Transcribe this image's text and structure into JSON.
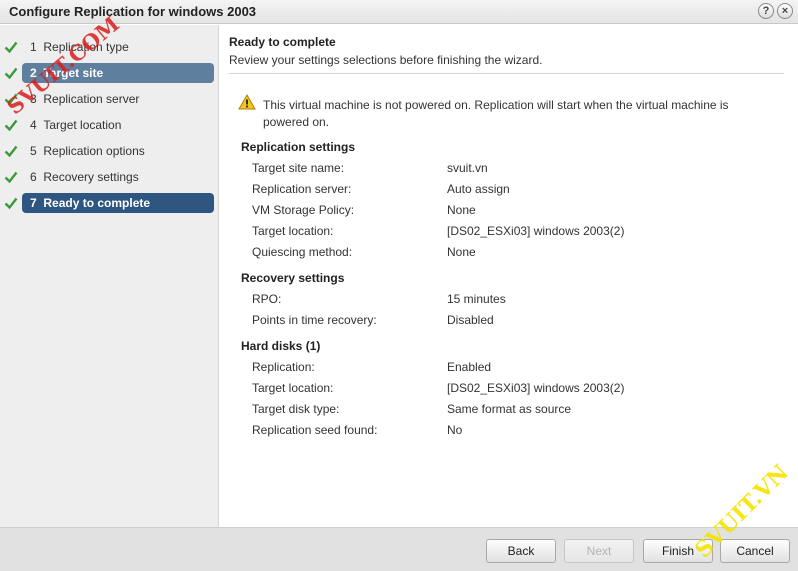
{
  "window": {
    "title": "Configure Replication for windows 2003",
    "help_glyph": "?",
    "close_glyph": "×"
  },
  "steps": [
    {
      "num": "1",
      "label": "Replication type",
      "state": "done"
    },
    {
      "num": "2",
      "label": "Target site",
      "state": "done-highlight"
    },
    {
      "num": "3",
      "label": "Replication server",
      "state": "done"
    },
    {
      "num": "4",
      "label": "Target location",
      "state": "done"
    },
    {
      "num": "5",
      "label": "Replication options",
      "state": "done"
    },
    {
      "num": "6",
      "label": "Recovery settings",
      "state": "done"
    },
    {
      "num": "7",
      "label": "Ready to complete",
      "state": "current"
    }
  ],
  "header": {
    "title": "Ready to complete",
    "subtitle": "Review your settings selections before finishing the wizard."
  },
  "warning": {
    "text": "This virtual machine is not powered on. Replication will start when the virtual machine is powered on."
  },
  "sections": {
    "replication": {
      "title": "Replication settings",
      "rows": [
        {
          "label": "Target site name:",
          "value": "svuit.vn"
        },
        {
          "label": "Replication server:",
          "value": "Auto assign"
        },
        {
          "label": "VM Storage Policy:",
          "value": "None"
        },
        {
          "label": "Target location:",
          "value": "[DS02_ESXi03] windows 2003(2)"
        },
        {
          "label": "Quiescing method:",
          "value": "None"
        }
      ]
    },
    "recovery": {
      "title": "Recovery settings",
      "rows": [
        {
          "label": "RPO:",
          "value": "15 minutes"
        },
        {
          "label": "Points in time recovery:",
          "value": "Disabled"
        }
      ]
    },
    "disks": {
      "title": "Hard disks (1)",
      "rows": [
        {
          "label": "Replication:",
          "value": "Enabled"
        },
        {
          "label": "Target location:",
          "value": "[DS02_ESXi03] windows 2003(2)"
        },
        {
          "label": "Target disk type:",
          "value": "Same format as source"
        },
        {
          "label": "Replication seed found:",
          "value": "No"
        }
      ]
    }
  },
  "buttons": {
    "back": "Back",
    "next": "Next",
    "finish": "Finish",
    "cancel": "Cancel"
  },
  "watermarks": {
    "top_left": "SVUIT.COM",
    "bottom_right": "SVUIT.VN"
  },
  "colors": {
    "check_green": "#3a9a3a",
    "step_highlight": "#5f7f9f",
    "step_current": "#2f5680",
    "watermark_red": "#d81e1e",
    "watermark_yellow": "#f5e400"
  }
}
